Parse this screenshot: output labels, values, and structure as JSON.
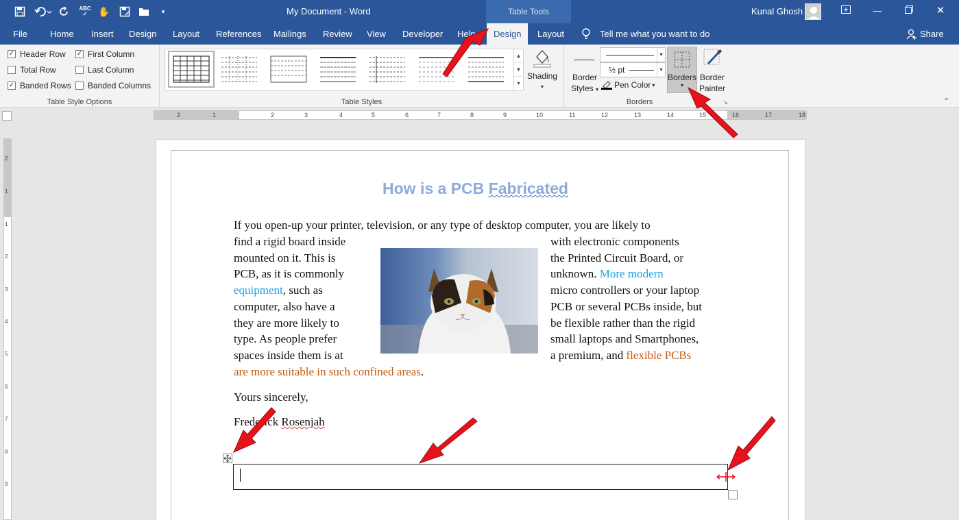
{
  "app": {
    "title": "My Document - Word",
    "contextual_tab": "Table Tools",
    "user": "Kunal Ghosh",
    "tell_me": "Tell me what you want to do",
    "share": "Share"
  },
  "tabs": [
    "File",
    "Home",
    "Insert",
    "Design",
    "Layout",
    "References",
    "Mailings",
    "Review",
    "View",
    "Developer",
    "Help",
    "Design",
    "Layout"
  ],
  "options": {
    "header_row": "Header Row",
    "first_column": "First Column",
    "total_row": "Total Row",
    "last_column": "Last Column",
    "banded_rows": "Banded Rows",
    "banded_columns": "Banded Columns",
    "group": "Table Style Options"
  },
  "styles": {
    "group": "Table Styles",
    "shading": "Shading"
  },
  "borders": {
    "styles_line1": "Border",
    "styles_line2": "Styles",
    "weight": "½ pt",
    "pen_color": "Pen Color",
    "borders_btn": "Borders",
    "painter_line1": "Border",
    "painter_line2": "Painter",
    "group": "Borders"
  },
  "ruler": {
    "top": [
      "2",
      "1",
      "1",
      "2",
      "3",
      "4",
      "5",
      "6",
      "7",
      "8",
      "9",
      "10",
      "11",
      "12",
      "13",
      "14",
      "15",
      "16",
      "17",
      "18"
    ],
    "left": [
      "2",
      "1",
      "1",
      "2",
      "3",
      "4",
      "5",
      "6",
      "7",
      "8",
      "9"
    ]
  },
  "doc": {
    "heading_pre": "How is a PCB ",
    "heading_word": "Fabricated",
    "line0": "If you open-up your printer, television, or any type of desktop computer, you are likely to",
    "left": [
      "find a rigid board inside",
      "mounted on it. This is",
      "PCB, as it is commonly",
      "equipment",
      ", such as",
      "computer, also have a",
      "they are more likely to",
      "type. As people prefer",
      "spaces inside them is at"
    ],
    "right": [
      "with electronic components",
      "the Printed Circuit Board, or",
      "unknown. ",
      "More modern",
      "micro controllers or your laptop",
      "PCB or several PCBs inside, but",
      "be flexible rather than the rigid",
      "small laptops and Smartphones,",
      "a premium, and ",
      "flexible PCBs"
    ],
    "tail": "are more suitable in such confined areas",
    "tail_end": ".",
    "closing": "Yours sincerely,",
    "sig_first": "Frederick ",
    "sig_last": "Rosenjah"
  },
  "colors": {
    "accent": "#2b579a",
    "link_blue": "#1ba1e2",
    "orange": "#c55a11",
    "heading": "#8eaadb",
    "arrow": "#e8121d"
  }
}
